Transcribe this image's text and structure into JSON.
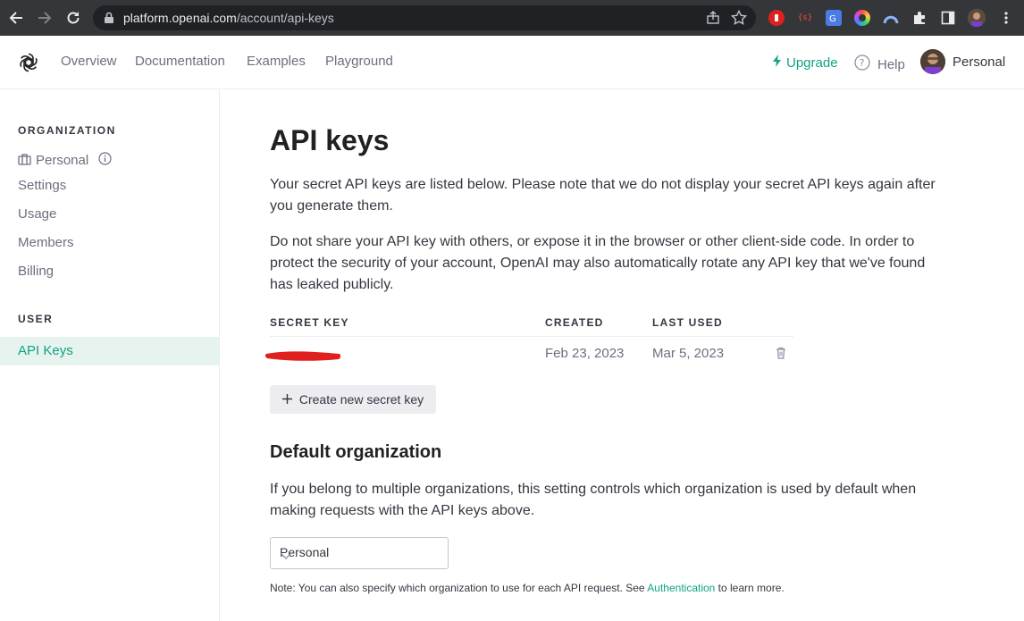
{
  "browser": {
    "url_host": "platform.openai.com",
    "url_path": "/account/api-keys",
    "extensions": [
      "adblock-icon",
      "json-ext-icon",
      "translate-icon",
      "color-ring-icon",
      "arc-icon",
      "puzzle-icon",
      "sidepanel-icon",
      "profile-avatar",
      "menu-icon"
    ]
  },
  "nav": {
    "links": [
      "Overview",
      "Documentation",
      "Examples",
      "Playground"
    ],
    "upgrade": "Upgrade",
    "help": "Help",
    "user": "Personal"
  },
  "sidebar": {
    "organization_heading": "ORGANIZATION",
    "org_name": "Personal",
    "org_items": [
      "Settings",
      "Usage",
      "Members",
      "Billing"
    ],
    "user_heading": "USER",
    "active_item": "API Keys"
  },
  "main": {
    "title": "API keys",
    "intro": "Your secret API keys are listed below. Please note that we do not display your secret API keys again after you generate them.",
    "warning": "Do not share your API key with others, or expose it in the browser or other client-side code. In order to protect the security of your account, OpenAI may also automatically rotate any API key that we've found has leaked publicly.",
    "table": {
      "headers": [
        "SECRET KEY",
        "CREATED",
        "LAST USED"
      ],
      "rows": [
        {
          "key": "",
          "created": "Feb 23, 2023",
          "last_used": "Mar 5, 2023"
        }
      ]
    },
    "create_button": "Create new secret key",
    "default_org_heading": "Default organization",
    "default_org_text": "If you belong to multiple organizations, this setting controls which organization is used by default when making requests with the API keys above.",
    "org_select_value": "Personal",
    "note_prefix": "Note: You can also specify which organization to use for each API request. See ",
    "note_link": "Authentication",
    "note_suffix": " to learn more."
  },
  "colors": {
    "accent": "#10a37f",
    "sidebar_active_bg": "#e6f3ef",
    "redaction": "#e0201f"
  }
}
